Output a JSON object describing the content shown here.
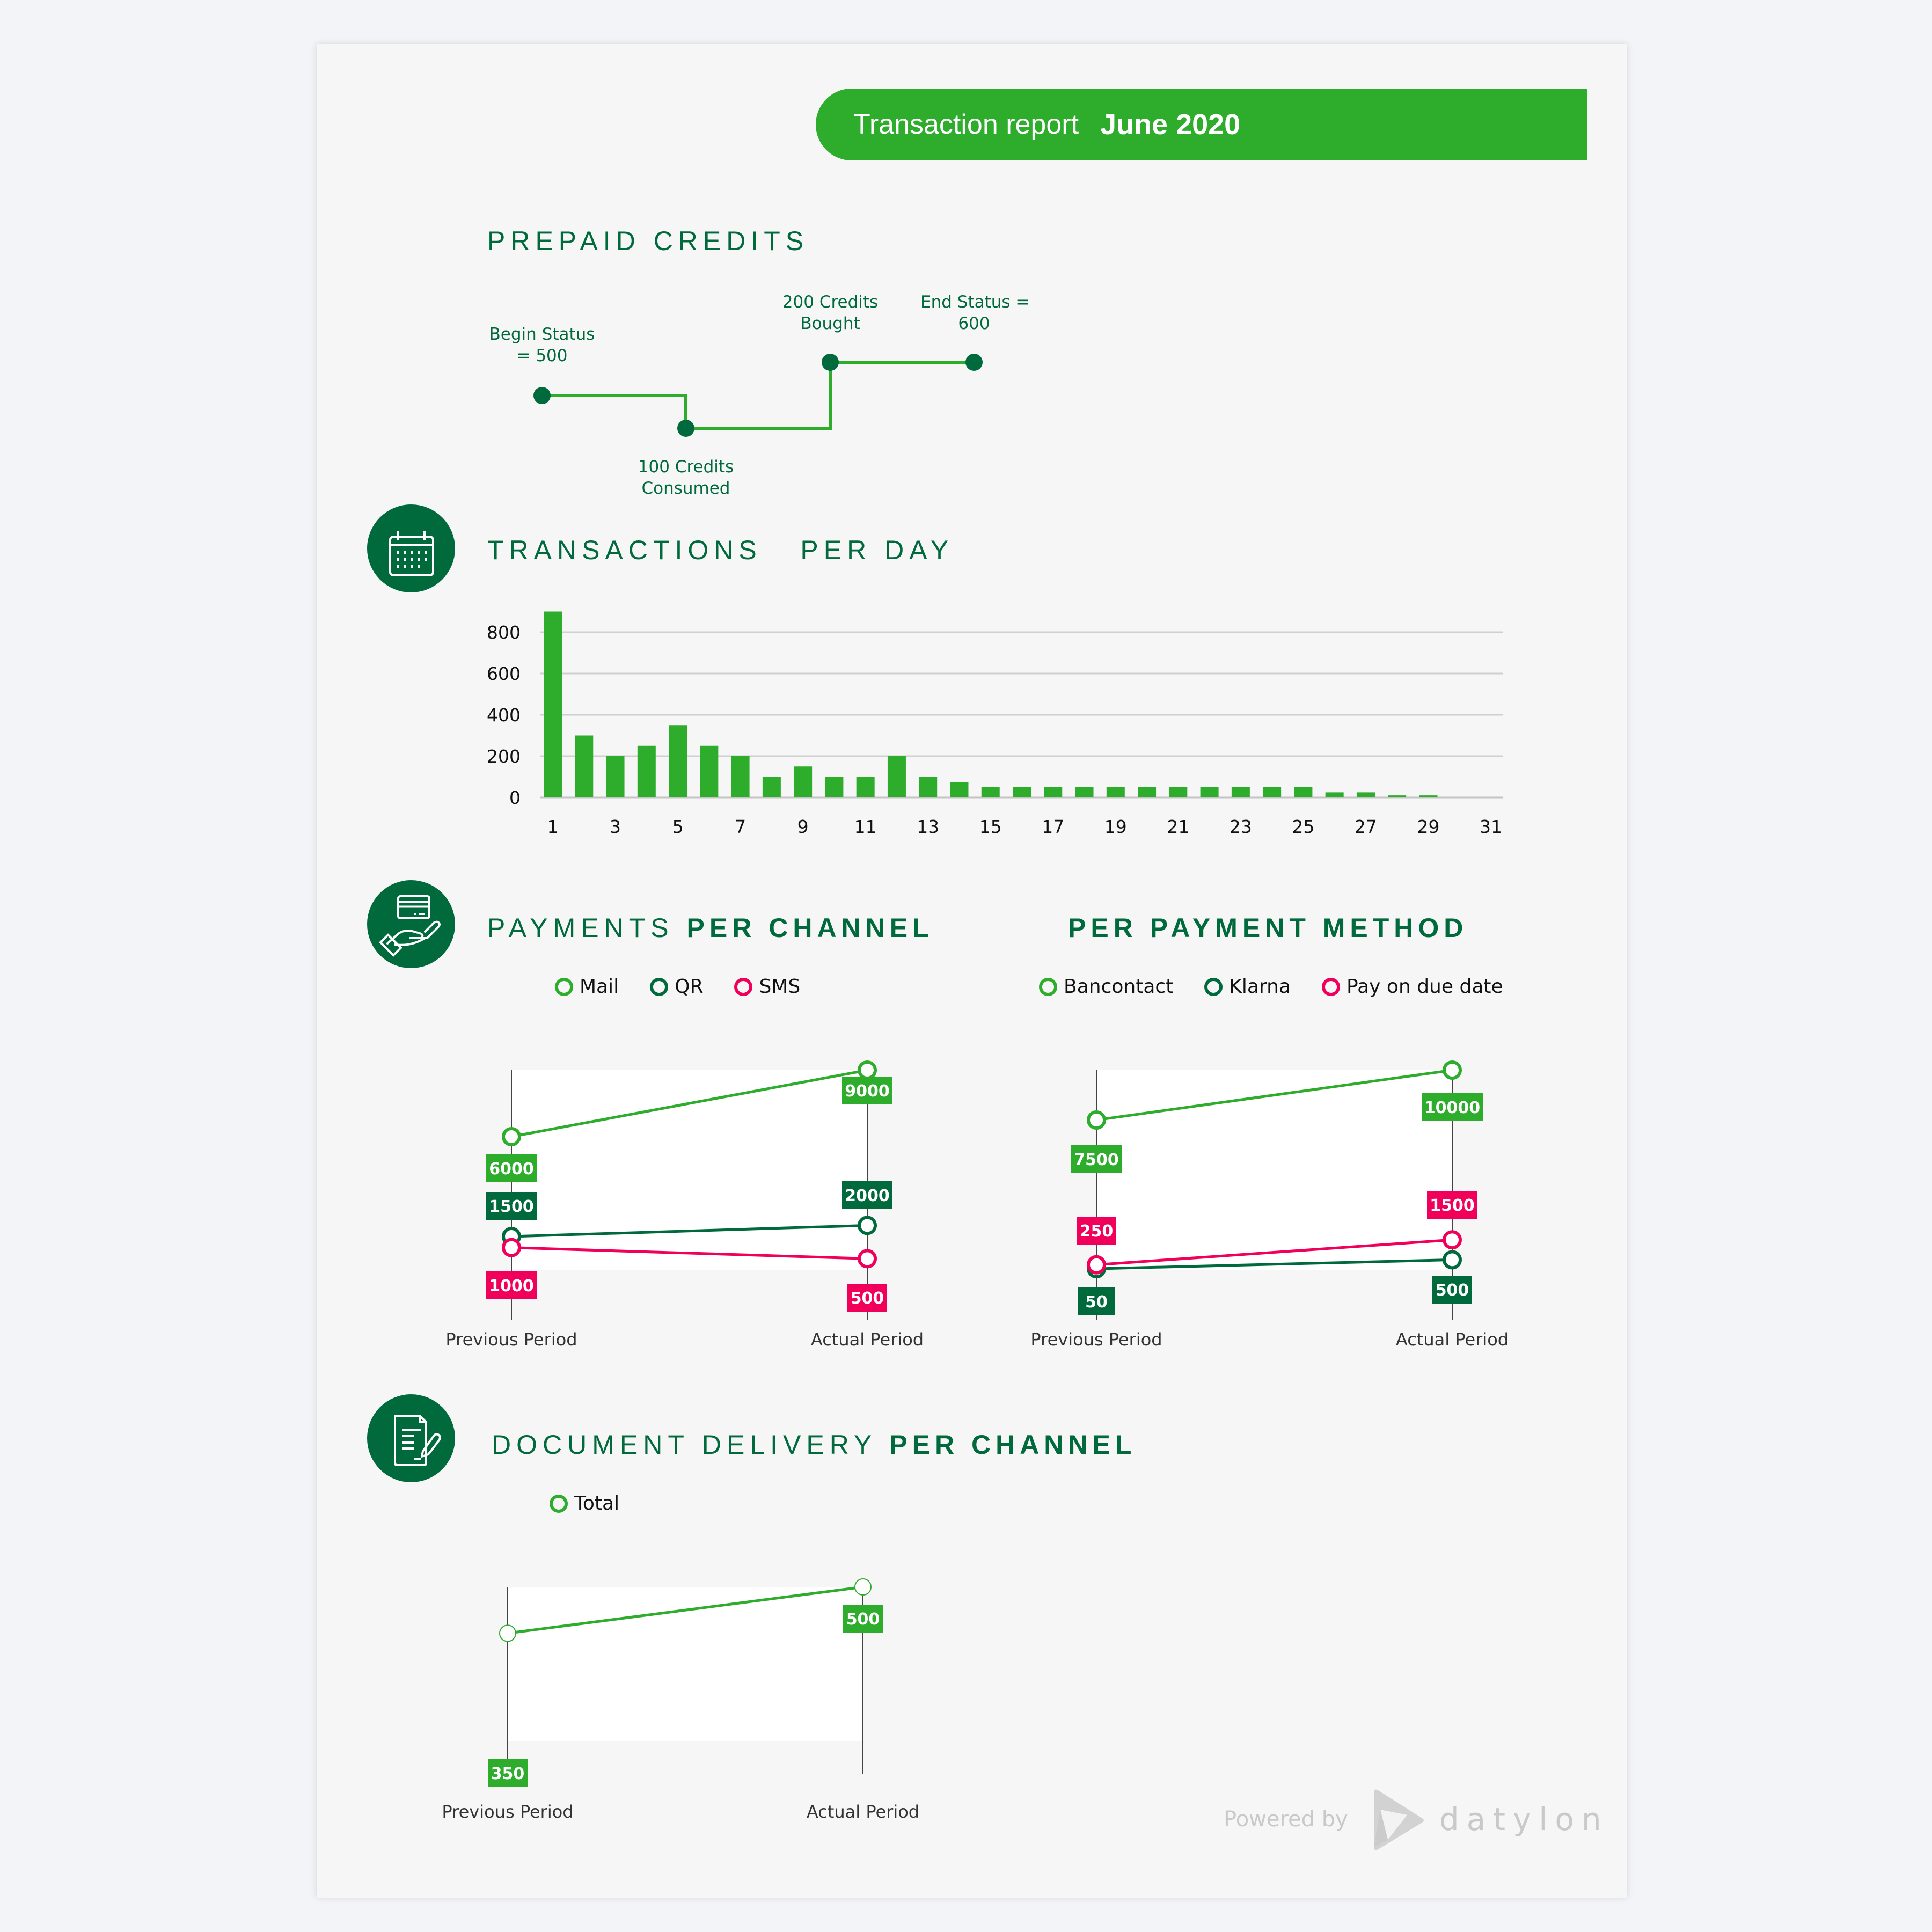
{
  "banner": {
    "title": "Transaction report",
    "period": "June 2020",
    "color": "#2eac2c"
  },
  "colors": {
    "primary": "#2eac2c",
    "dark": "#006a3d",
    "accent": "#f0005a",
    "grid": "#d8d8d8",
    "text": "#222222"
  },
  "prepaid": {
    "heading": "PREPAID  CREDITS",
    "steps": [
      {
        "label_line1": "Begin Status",
        "label_line2": "= 500",
        "value": 500
      },
      {
        "label_line1": "100 Credits",
        "label_line2": "Consumed",
        "value": 400
      },
      {
        "label_line1": "200 Credits",
        "label_line2": "Bought",
        "value": 600
      },
      {
        "label_line1": "End Status =",
        "label_line2": "600",
        "value": 600
      }
    ]
  },
  "transactions": {
    "heading_light": "TRANSACTIONS",
    "heading_light2": "PER DAY",
    "icon": "calendar-icon"
  },
  "payments": {
    "heading_light": "PAYMENTS",
    "heading_bold": "PER CHANNEL",
    "heading2_bold": "PER PAYMENT METHOD",
    "icon": "hand-card-icon"
  },
  "documents": {
    "heading_light": "DOCUMENT DELIVERY",
    "heading_bold": "PER CHANNEL",
    "icon": "document-pen-icon"
  },
  "footer": {
    "powered_by": "Powered by",
    "brand": "datylon"
  },
  "chart_data": [
    {
      "id": "transactions-per-day",
      "type": "bar",
      "title": "TRANSACTIONS PER DAY",
      "xlabel": "",
      "ylabel": "",
      "categories": [
        1,
        2,
        3,
        4,
        5,
        6,
        7,
        8,
        9,
        10,
        11,
        12,
        13,
        14,
        15,
        16,
        17,
        18,
        19,
        20,
        21,
        22,
        23,
        24,
        25,
        26,
        27,
        28,
        29,
        30,
        31
      ],
      "x_tick_labels": [
        "1",
        "3",
        "5",
        "7",
        "9",
        "11",
        "13",
        "15",
        "17",
        "19",
        "21",
        "23",
        "25",
        "27",
        "29",
        "31"
      ],
      "values": [
        900,
        300,
        200,
        250,
        350,
        250,
        200,
        100,
        150,
        100,
        100,
        200,
        100,
        75,
        50,
        50,
        50,
        50,
        50,
        50,
        50,
        50,
        50,
        50,
        50,
        25,
        25,
        10,
        10,
        0,
        0
      ],
      "y_ticks": [
        0,
        200,
        400,
        600,
        800
      ],
      "ylim": [
        0,
        900
      ],
      "grid": true,
      "color": "#2eac2c"
    },
    {
      "id": "payments-per-channel",
      "type": "line",
      "title": "PAYMENTS PER CHANNEL",
      "categories": [
        "Previous Period",
        "Actual Period"
      ],
      "series": [
        {
          "name": "Mail",
          "values": [
            6000,
            9000
          ],
          "color": "#2eac2c"
        },
        {
          "name": "QR",
          "values": [
            1500,
            2000
          ],
          "color": "#006a3d"
        },
        {
          "name": "SMS",
          "values": [
            1000,
            500
          ],
          "color": "#f0005a"
        }
      ],
      "legend": "top"
    },
    {
      "id": "per-payment-method",
      "type": "line",
      "title": "PER PAYMENT METHOD",
      "categories": [
        "Previous Period",
        "Actual Period"
      ],
      "series": [
        {
          "name": "Bancontact",
          "values": [
            7500,
            10000
          ],
          "color": "#2eac2c"
        },
        {
          "name": "Klarna",
          "values": [
            50,
            500
          ],
          "color": "#006a3d"
        },
        {
          "name": "Pay on due date",
          "values": [
            250,
            1500
          ],
          "color": "#f0005a"
        }
      ],
      "legend": "top"
    },
    {
      "id": "document-delivery-per-channel",
      "type": "line",
      "title": "DOCUMENT DELIVERY PER CHANNEL",
      "categories": [
        "Previous Period",
        "Actual Period"
      ],
      "series": [
        {
          "name": "Total",
          "values": [
            350,
            500
          ],
          "color": "#2eac2c"
        }
      ],
      "legend": "top"
    }
  ]
}
